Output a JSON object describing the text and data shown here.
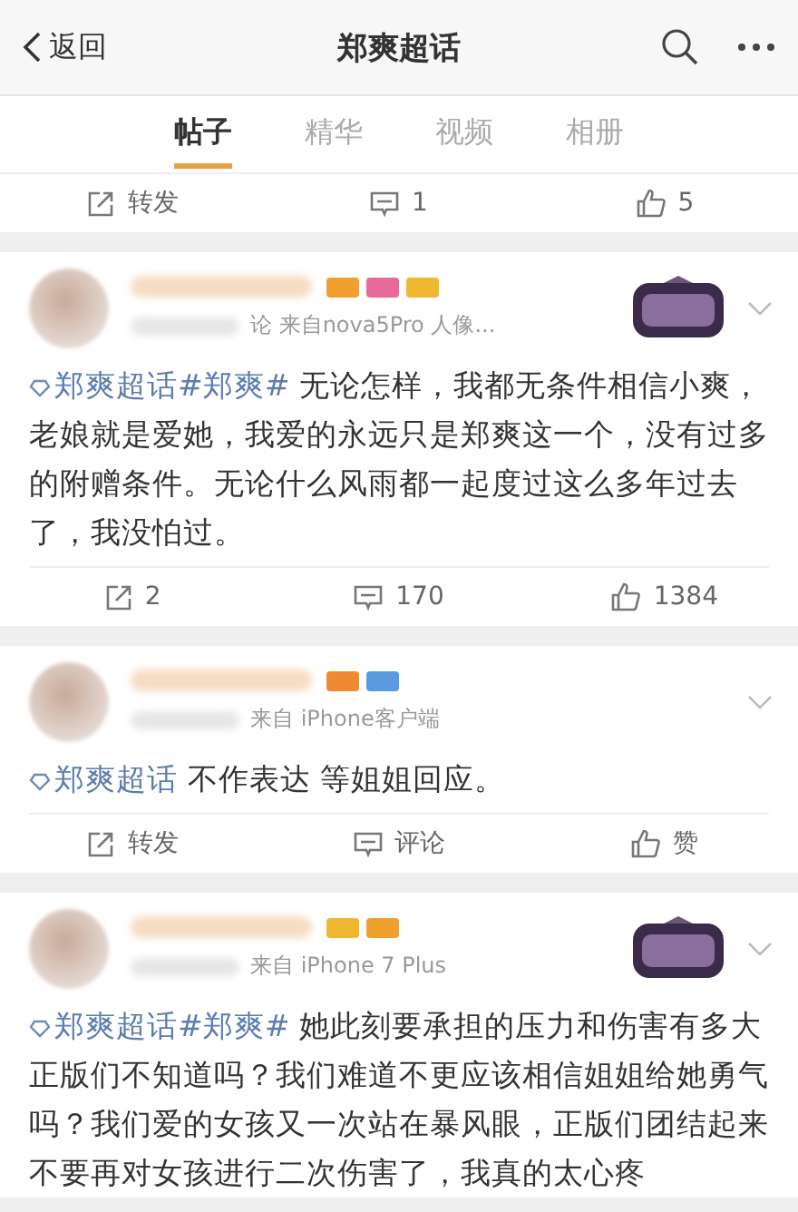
{
  "header": {
    "back": "返回",
    "title": "郑爽超话"
  },
  "tabs": [
    {
      "label": "帖子",
      "selected": true
    },
    {
      "label": "精华",
      "selected": false
    },
    {
      "label": "视频",
      "selected": false
    },
    {
      "label": "相册",
      "selected": false
    }
  ],
  "previous_post_actions": {
    "repost": "转发",
    "comment": "1",
    "like": "5"
  },
  "posts": [
    {
      "source": "论 来自nova5Pro 人像...",
      "event_badge": true,
      "badges": [
        {
          "color": "#f0a030"
        },
        {
          "color": "#e86a9a"
        },
        {
          "color": "#f0b830"
        }
      ],
      "topic": "郑爽超话#郑爽#",
      "text": "无论怎样，我都无条件相信小爽，老娘就是爱她，我爱的永远只是郑爽这一个，没有过多的附赠条件。无论什么风雨都一起度过这么多年过去了，我没怕过。",
      "actions": {
        "repost": "2",
        "comment": "170",
        "like": "1384"
      }
    },
    {
      "source": "来自 iPhone客户端",
      "badges": [
        {
          "color": "#f08a30"
        },
        {
          "color": "#5a9ae0"
        }
      ],
      "topic": "郑爽超话",
      "text": "不作表达 等姐姐回应。",
      "actions": {
        "repost": "转发",
        "comment": "评论",
        "like": "赞"
      }
    },
    {
      "source": "来自 iPhone 7 Plus",
      "event_badge": true,
      "badges": [
        {
          "color": "#f0b830"
        },
        {
          "color": "#f0a030"
        }
      ],
      "topic": "郑爽超话#郑爽#",
      "text": "她此刻要承担的压力和伤害有多大正版们不知道吗？我们难道不更应该相信姐姐给她勇气吗？我们爱的女孩又一次站在暴风眼，正版们团结起来不要再对女孩进行二次伤害了，我真的太心疼"
    }
  ]
}
